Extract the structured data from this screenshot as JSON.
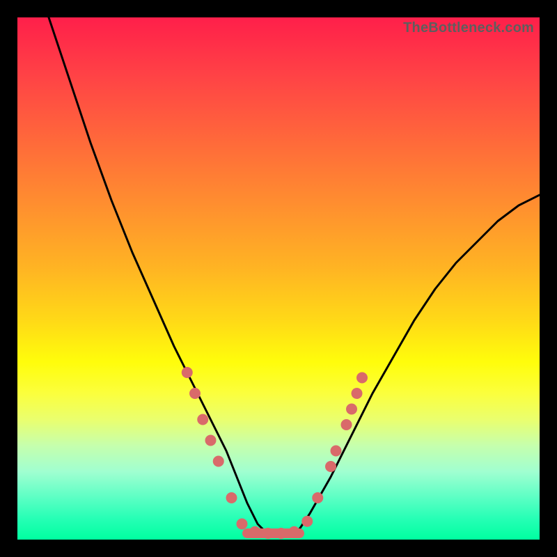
{
  "watermark": "TheBottleneck.com",
  "chart_data": {
    "type": "line",
    "title": "",
    "xlabel": "",
    "ylabel": "",
    "xlim": [
      0,
      100
    ],
    "ylim": [
      0,
      100
    ],
    "grid": false,
    "legend": false,
    "series": [
      {
        "name": "bottleneck-curve",
        "x": [
          6,
          10,
          14,
          18,
          22,
          26,
          30,
          32,
          34,
          36,
          38,
          40,
          42,
          44,
          46,
          48,
          50,
          52,
          54,
          56,
          60,
          64,
          68,
          72,
          76,
          80,
          84,
          88,
          92,
          96,
          100
        ],
        "y": [
          100,
          88,
          76,
          65,
          55,
          46,
          37,
          33,
          29,
          25,
          21,
          17,
          12,
          7,
          3,
          1,
          1,
          1,
          2,
          5,
          12,
          20,
          28,
          35,
          42,
          48,
          53,
          57,
          61,
          64,
          66
        ]
      }
    ],
    "markers": [
      {
        "x": 32.5,
        "y": 32
      },
      {
        "x": 34,
        "y": 28
      },
      {
        "x": 35.5,
        "y": 23
      },
      {
        "x": 37,
        "y": 19
      },
      {
        "x": 38.5,
        "y": 15
      },
      {
        "x": 41,
        "y": 8
      },
      {
        "x": 43,
        "y": 3
      },
      {
        "x": 45.5,
        "y": 1.5
      },
      {
        "x": 48,
        "y": 1.2
      },
      {
        "x": 50.5,
        "y": 1.2
      },
      {
        "x": 53,
        "y": 1.5
      },
      {
        "x": 55.5,
        "y": 3.5
      },
      {
        "x": 57.5,
        "y": 8
      },
      {
        "x": 60,
        "y": 14
      },
      {
        "x": 61,
        "y": 17
      },
      {
        "x": 63,
        "y": 22
      },
      {
        "x": 64,
        "y": 25
      },
      {
        "x": 65,
        "y": 28
      },
      {
        "x": 66,
        "y": 31
      }
    ],
    "flat_bottom": {
      "x0": 44,
      "x1": 54,
      "y": 1.2
    },
    "colors": {
      "curve": "#000000",
      "markers": "#d96a6a",
      "gradient_top": "#ff1f4a",
      "gradient_bottom": "#00ffa0"
    }
  }
}
